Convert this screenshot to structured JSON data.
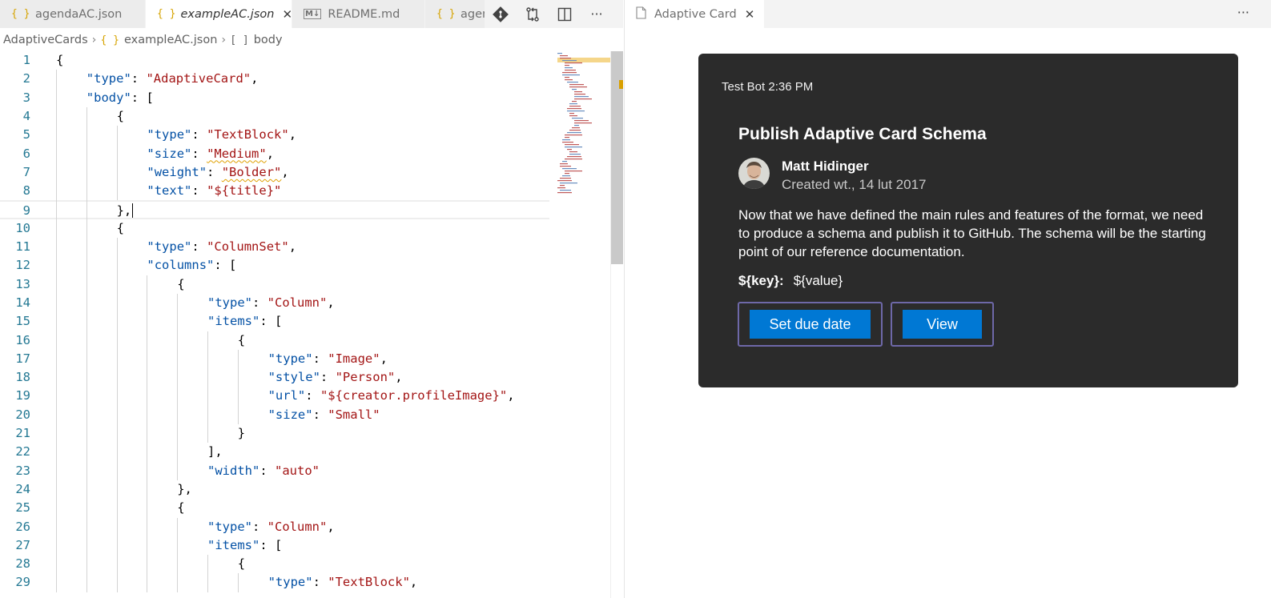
{
  "tabs": [
    {
      "label": "agendaAC.json",
      "icon": "json-braces-icon",
      "active": false
    },
    {
      "label": "exampleAC.json",
      "icon": "json-braces-icon",
      "active": true
    },
    {
      "label": "README.md",
      "icon": "markdown-icon",
      "active": false
    },
    {
      "label": "agen",
      "icon": "json-braces-icon",
      "active": false
    }
  ],
  "tab_icon_glyphs": {
    "json": "{ }",
    "markdown": "M↓"
  },
  "editor_actions": [
    "git-icon",
    "compare-changes-icon",
    "split-editor-icon",
    "more-actions-icon"
  ],
  "breadcrumb": {
    "folder": "AdaptiveCards",
    "file": "exampleAC.json",
    "symbol": "body"
  },
  "editor": {
    "cursor_line": 9,
    "lines": [
      {
        "n": "1",
        "indent": 0,
        "tokens": [
          [
            "p",
            "{"
          ]
        ]
      },
      {
        "n": "2",
        "indent": 1,
        "tokens": [
          [
            "k",
            "\"type\""
          ],
          [
            "p",
            ": "
          ],
          [
            "s",
            "\"AdaptiveCard\""
          ],
          [
            "p",
            ","
          ]
        ]
      },
      {
        "n": "3",
        "indent": 1,
        "tokens": [
          [
            "k",
            "\"body\""
          ],
          [
            "p",
            ": ["
          ]
        ]
      },
      {
        "n": "4",
        "indent": 2,
        "tokens": [
          [
            "p",
            "{"
          ]
        ]
      },
      {
        "n": "5",
        "indent": 3,
        "tokens": [
          [
            "k",
            "\"type\""
          ],
          [
            "p",
            ": "
          ],
          [
            "s",
            "\"TextBlock\""
          ],
          [
            "p",
            ","
          ]
        ]
      },
      {
        "n": "6",
        "indent": 3,
        "tokens": [
          [
            "k",
            "\"size\""
          ],
          [
            "p",
            ": "
          ],
          [
            "s~",
            "\"Medium\""
          ],
          [
            "p",
            ","
          ]
        ]
      },
      {
        "n": "7",
        "indent": 3,
        "tokens": [
          [
            "k",
            "\"weight\""
          ],
          [
            "p",
            ": "
          ],
          [
            "s~",
            "\"Bolder\""
          ],
          [
            "p",
            ","
          ]
        ]
      },
      {
        "n": "8",
        "indent": 3,
        "tokens": [
          [
            "k",
            "\"text\""
          ],
          [
            "p",
            ": "
          ],
          [
            "s",
            "\"${title}\""
          ]
        ]
      },
      {
        "n": "9",
        "indent": 2,
        "tokens": [
          [
            "p",
            "},"
          ]
        ]
      },
      {
        "n": "10",
        "indent": 2,
        "tokens": [
          [
            "p",
            "{"
          ]
        ]
      },
      {
        "n": "11",
        "indent": 3,
        "tokens": [
          [
            "k",
            "\"type\""
          ],
          [
            "p",
            ": "
          ],
          [
            "s",
            "\"ColumnSet\""
          ],
          [
            "p",
            ","
          ]
        ]
      },
      {
        "n": "12",
        "indent": 3,
        "tokens": [
          [
            "k",
            "\"columns\""
          ],
          [
            "p",
            ": ["
          ]
        ]
      },
      {
        "n": "13",
        "indent": 4,
        "tokens": [
          [
            "p",
            "{"
          ]
        ]
      },
      {
        "n": "14",
        "indent": 5,
        "tokens": [
          [
            "k",
            "\"type\""
          ],
          [
            "p",
            ": "
          ],
          [
            "s",
            "\"Column\""
          ],
          [
            "p",
            ","
          ]
        ]
      },
      {
        "n": "15",
        "indent": 5,
        "tokens": [
          [
            "k",
            "\"items\""
          ],
          [
            "p",
            ": ["
          ]
        ]
      },
      {
        "n": "16",
        "indent": 6,
        "tokens": [
          [
            "p",
            "{"
          ]
        ]
      },
      {
        "n": "17",
        "indent": 7,
        "tokens": [
          [
            "k",
            "\"type\""
          ],
          [
            "p",
            ": "
          ],
          [
            "s",
            "\"Image\""
          ],
          [
            "p",
            ","
          ]
        ]
      },
      {
        "n": "18",
        "indent": 7,
        "tokens": [
          [
            "k",
            "\"style\""
          ],
          [
            "p",
            ": "
          ],
          [
            "s",
            "\"Person\""
          ],
          [
            "p",
            ","
          ]
        ]
      },
      {
        "n": "19",
        "indent": 7,
        "tokens": [
          [
            "k",
            "\"url\""
          ],
          [
            "p",
            ": "
          ],
          [
            "s",
            "\"${creator.profileImage}\""
          ],
          [
            "p",
            ","
          ]
        ]
      },
      {
        "n": "20",
        "indent": 7,
        "tokens": [
          [
            "k",
            "\"size\""
          ],
          [
            "p",
            ": "
          ],
          [
            "s",
            "\"Small\""
          ]
        ]
      },
      {
        "n": "21",
        "indent": 6,
        "tokens": [
          [
            "p",
            "}"
          ]
        ]
      },
      {
        "n": "22",
        "indent": 5,
        "tokens": [
          [
            "p",
            "],"
          ]
        ]
      },
      {
        "n": "23",
        "indent": 5,
        "tokens": [
          [
            "k",
            "\"width\""
          ],
          [
            "p",
            ": "
          ],
          [
            "s",
            "\"auto\""
          ]
        ]
      },
      {
        "n": "24",
        "indent": 4,
        "tokens": [
          [
            "p",
            "},"
          ]
        ]
      },
      {
        "n": "25",
        "indent": 4,
        "tokens": [
          [
            "p",
            "{"
          ]
        ]
      },
      {
        "n": "26",
        "indent": 5,
        "tokens": [
          [
            "k",
            "\"type\""
          ],
          [
            "p",
            ": "
          ],
          [
            "s",
            "\"Column\""
          ],
          [
            "p",
            ","
          ]
        ]
      },
      {
        "n": "27",
        "indent": 5,
        "tokens": [
          [
            "k",
            "\"items\""
          ],
          [
            "p",
            ": ["
          ]
        ]
      },
      {
        "n": "28",
        "indent": 6,
        "tokens": [
          [
            "p",
            "{"
          ]
        ]
      },
      {
        "n": "29",
        "indent": 7,
        "tokens": [
          [
            "k",
            "\"type\""
          ],
          [
            "p",
            ": "
          ],
          [
            "s",
            "\"TextBlock\""
          ],
          [
            "p",
            ","
          ]
        ]
      }
    ]
  },
  "preview": {
    "tab_label": "Adaptive Card",
    "tab_icon": "file-icon",
    "card": {
      "header": "Test Bot 2:36 PM",
      "title": "Publish Adaptive Card Schema",
      "author": "Matt Hidinger",
      "created": "Created wt., 14 lut 2017",
      "body": "Now that we have defined the main rules and features of the format, we need to produce a schema and publish it to GitHub. The schema will be the starting point of our reference documentation.",
      "fact_key": "${key}:",
      "fact_value": "${value}",
      "actions": [
        "Set due date",
        "View"
      ]
    }
  },
  "colors": {
    "accent": "#0078d4",
    "card_background": "#2b2b2b",
    "button_focus_border": "#6e68a8",
    "json_key": "#0451a5",
    "json_string": "#a31515",
    "line_number": "#237893",
    "json_icon": "#d6a300"
  }
}
